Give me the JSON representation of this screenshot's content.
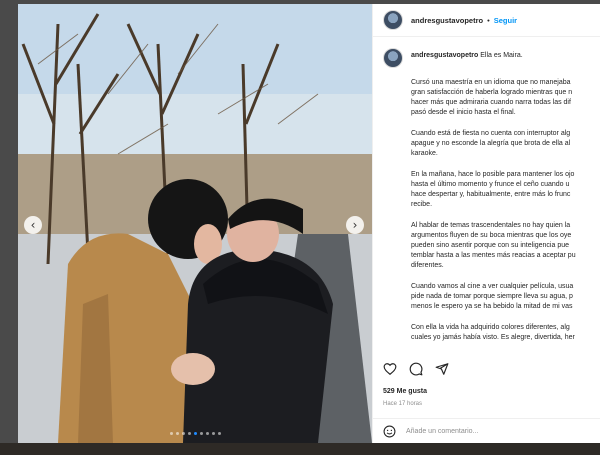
{
  "post": {
    "username": "andresgustavopetro",
    "separator": "•",
    "follow_label": "Seguir",
    "caption_title": "Ella es Maira.",
    "caption_paragraphs": [
      "Cursó una maestría en un idioma que no manejaba\ngran satisfacción de haberla logrado mientras que n\nhacer más que admiraria cuando narra todas las dif\npasó desde el inicio hasta el final.",
      "Cuando está de fiesta no cuenta con interruptor alg\napague y no esconde la alegría que brota de ella al\nkaraoke.",
      "En la mañana, hace lo posible para mantener los ojo\nhasta el último momento y frunce el ceño cuando u\nhace despertar y, habitualmente, entre más lo frunc\nrecibe.",
      "Al hablar de temas trascendentales no hay quien la\nargumentos fluyen de su boca mientras que los oye\npueden sino asentir porque con su inteligencia pue\ntemblar hasta a las mentes más reacias a aceptar pu\ndiferentes.",
      "Cuando vamos al cine a ver cualquier película, usua\npide nada de tomar porque siempre lleva su agua, p\nmenos le espero ya se ha bebido la mitad de mi vas",
      "Con ella la vida ha adquirido colores diferentes, alg\ncuales yo jamás había visto. Es alegre, divertida, her"
    ],
    "likes_label": "529 Me gusta",
    "time_label": "Hace 17 horas",
    "comment_placeholder": "Añade un comentario...",
    "nav_prev": "‹",
    "nav_next": "›",
    "carousel_count": 9,
    "carousel_active_index": 4
  },
  "icons": {
    "like": "heart-icon",
    "comment": "comment-icon",
    "share": "send-icon",
    "emoji": "smiley-icon"
  },
  "colors": {
    "follow": "#0095f6",
    "active_dot": "#1f8bff"
  }
}
